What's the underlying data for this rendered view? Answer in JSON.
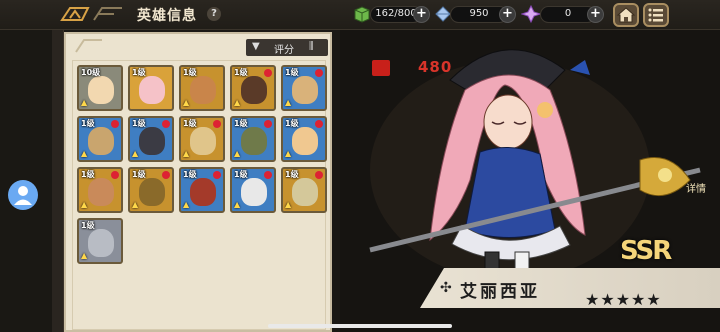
{
  "header": {
    "title": "英雄信息",
    "help_label": "?",
    "stamina": "162/800",
    "crystals": "950",
    "gems": "0",
    "plus": "+"
  },
  "colors": {
    "background": "#1b1915",
    "panel": "#ebe3cf",
    "power_red": "#d8342a",
    "rarity_gold": "#f5d57a"
  },
  "filter": {
    "label": "评分",
    "icon": "funnel-icon",
    "sort_icon": "sort-bars-icon"
  },
  "heroes": [
    {
      "level": "10级",
      "bg": "#8a8a7a",
      "face": "#f2d8b0",
      "alert": false,
      "up": true
    },
    {
      "level": "1级",
      "bg": "#d9a23a",
      "face": "#f5c2c8",
      "alert": false,
      "up": false
    },
    {
      "level": "1级",
      "bg": "#c7922e",
      "face": "#c9854a",
      "alert": false,
      "up": true
    },
    {
      "level": "1级",
      "bg": "#c7922e",
      "face": "#5a3a28",
      "alert": true,
      "up": true
    },
    {
      "level": "1级",
      "bg": "#3f7ec2",
      "face": "#d9b27a",
      "alert": true,
      "up": true
    },
    {
      "level": "1级",
      "bg": "#3f7ec2",
      "face": "#c9a56e",
      "alert": true,
      "up": true
    },
    {
      "level": "1级",
      "bg": "#3f7ec2",
      "face": "#3b3b44",
      "alert": true,
      "up": true
    },
    {
      "level": "1级",
      "bg": "#c7922e",
      "face": "#e0c58a",
      "alert": true,
      "up": true
    },
    {
      "level": "1级",
      "bg": "#3f7ec2",
      "face": "#6f7a4a",
      "alert": true,
      "up": true
    },
    {
      "level": "1级",
      "bg": "#3f7ec2",
      "face": "#f0c890",
      "alert": true,
      "up": true
    },
    {
      "level": "1级",
      "bg": "#c7922e",
      "face": "#c98a5a",
      "alert": true,
      "up": true
    },
    {
      "level": "1级",
      "bg": "#c7922e",
      "face": "#8a6a2a",
      "alert": true,
      "up": true
    },
    {
      "level": "1级",
      "bg": "#3f7ec2",
      "face": "#a43a2a",
      "alert": true,
      "up": true
    },
    {
      "level": "1级",
      "bg": "#3f7ec2",
      "face": "#e8e8e8",
      "alert": true,
      "up": true
    },
    {
      "level": "1级",
      "bg": "#c7922e",
      "face": "#d4c89a",
      "alert": true,
      "up": true
    },
    {
      "level": "1级",
      "bg": "#8a8f9a",
      "face": "#b8bcc4",
      "alert": false,
      "up": true
    }
  ],
  "hero_detail": {
    "power": "480",
    "detail_label": "详情",
    "rarity": "SSR",
    "name": "艾丽西亚",
    "stars": "★★★★★"
  }
}
